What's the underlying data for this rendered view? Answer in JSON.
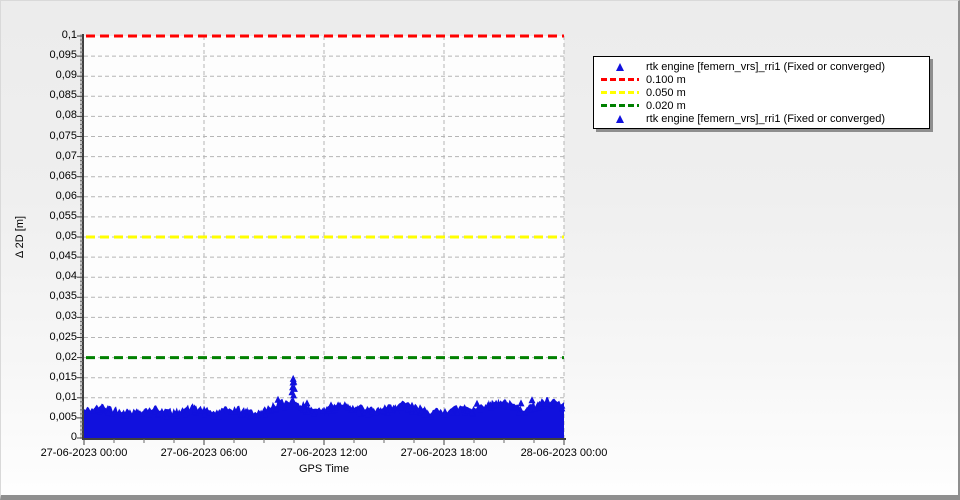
{
  "window": {
    "bg_top": "#ececec",
    "bg_bottom": "#fefefe",
    "border_color": "#8f8f8f",
    "plot_bg": "#fdfdfd",
    "grid_color": "#b5b5b5",
    "axis_color": "#3f3f3f"
  },
  "chart_data": {
    "type": "scatter",
    "title": "",
    "xlabel": "GPS Time",
    "ylabel": "Δ 2D [m]",
    "ylim": [
      0,
      0.1
    ],
    "y_tick_step": 0.005,
    "grid": true,
    "y_ticks": [
      {
        "v": 0.0,
        "label": "0"
      },
      {
        "v": 0.005,
        "label": "0,005"
      },
      {
        "v": 0.01,
        "label": "0,01"
      },
      {
        "v": 0.015,
        "label": "0,015"
      },
      {
        "v": 0.02,
        "label": "0,02"
      },
      {
        "v": 0.025,
        "label": "0,025"
      },
      {
        "v": 0.03,
        "label": "0,03"
      },
      {
        "v": 0.035,
        "label": "0,035"
      },
      {
        "v": 0.04,
        "label": "0,04"
      },
      {
        "v": 0.045,
        "label": "0,045"
      },
      {
        "v": 0.05,
        "label": "0,05"
      },
      {
        "v": 0.055,
        "label": "0,055"
      },
      {
        "v": 0.06,
        "label": "0,06"
      },
      {
        "v": 0.065,
        "label": "0,065"
      },
      {
        "v": 0.07,
        "label": "0,07"
      },
      {
        "v": 0.075,
        "label": "0,075"
      },
      {
        "v": 0.08,
        "label": "0,08"
      },
      {
        "v": 0.085,
        "label": "0,085"
      },
      {
        "v": 0.09,
        "label": "0,09"
      },
      {
        "v": 0.095,
        "label": "0,095"
      },
      {
        "v": 0.1,
        "label": "0,1"
      }
    ],
    "x_range_hours": [
      0,
      24
    ],
    "x_ticks": [
      {
        "t": 0,
        "label": "27-06-2023 00:00"
      },
      {
        "t": 6,
        "label": "27-06-2023 06:00"
      },
      {
        "t": 12,
        "label": "27-06-2023 12:00"
      },
      {
        "t": 18,
        "label": "27-06-2023 18:00"
      },
      {
        "t": 24,
        "label": "28-06-2023 00:00"
      }
    ],
    "reference_lines": [
      {
        "value": 0.1,
        "label": "0.100 m",
        "color": "#ff0000"
      },
      {
        "value": 0.05,
        "label": "0.050 m",
        "color": "#ffff00"
      },
      {
        "value": 0.02,
        "label": "0.020 m",
        "color": "#008000"
      }
    ],
    "series": [
      {
        "name": "rtk engine [femern_vrs]_rri1 (Fixed or converged)",
        "marker": "triangle",
        "color": "#1111dd",
        "description": "dense scatter band of fix solutions between 0 and ~0.010 m",
        "envelope_t_step_hours": 0.5,
        "envelope_top_m": [
          0.007,
          0.0075,
          0.008,
          0.0074,
          0.0069,
          0.0067,
          0.0072,
          0.0076,
          0.007,
          0.0066,
          0.0074,
          0.0079,
          0.0072,
          0.0066,
          0.007,
          0.0076,
          0.0071,
          0.0066,
          0.0071,
          0.0085,
          0.0091,
          0.0096,
          0.0082,
          0.0075,
          0.0071,
          0.0084,
          0.0089,
          0.008,
          0.0075,
          0.007,
          0.0075,
          0.008,
          0.0085,
          0.0079,
          0.0074,
          0.0066,
          0.007,
          0.0075,
          0.008,
          0.0075,
          0.0084,
          0.009,
          0.0095,
          0.008,
          0.0075,
          0.0085,
          0.0095,
          0.009,
          0.0085
        ],
        "outliers": [
          {
            "t": 9.7,
            "y": 0.0105
          },
          {
            "t": 10.4,
            "y": 0.0124
          },
          {
            "t": 10.43,
            "y": 0.0136
          },
          {
            "t": 10.45,
            "y": 0.0148
          },
          {
            "t": 10.46,
            "y": 0.0157
          },
          {
            "t": 10.49,
            "y": 0.015
          },
          {
            "t": 10.52,
            "y": 0.0132
          },
          {
            "t": 10.48,
            "y": 0.0116
          },
          {
            "t": 11.15,
            "y": 0.0096
          },
          {
            "t": 12.35,
            "y": 0.0091
          },
          {
            "t": 16.4,
            "y": 0.009
          },
          {
            "t": 19.65,
            "y": 0.0095
          },
          {
            "t": 20.6,
            "y": 0.0094
          },
          {
            "t": 21.85,
            "y": 0.0096
          },
          {
            "t": 22.4,
            "y": 0.0104
          },
          {
            "t": 23.1,
            "y": 0.0095
          }
        ]
      }
    ],
    "legend": {
      "position": "top-right",
      "entries": [
        {
          "marker": "triangle",
          "color": "#1111dd",
          "label": "rtk engine [femern_vrs]_rri1 (Fixed or converged)"
        },
        {
          "marker": "dash",
          "color": "#ff0000",
          "label": "0.100 m"
        },
        {
          "marker": "dash",
          "color": "#ffff00",
          "label": "0.050 m"
        },
        {
          "marker": "dash",
          "color": "#008000",
          "label": "0.020 m"
        },
        {
          "marker": "triangle",
          "color": "#1111dd",
          "label": "rtk engine [femern_vrs]_rri1 (Fixed or converged)"
        }
      ]
    }
  }
}
